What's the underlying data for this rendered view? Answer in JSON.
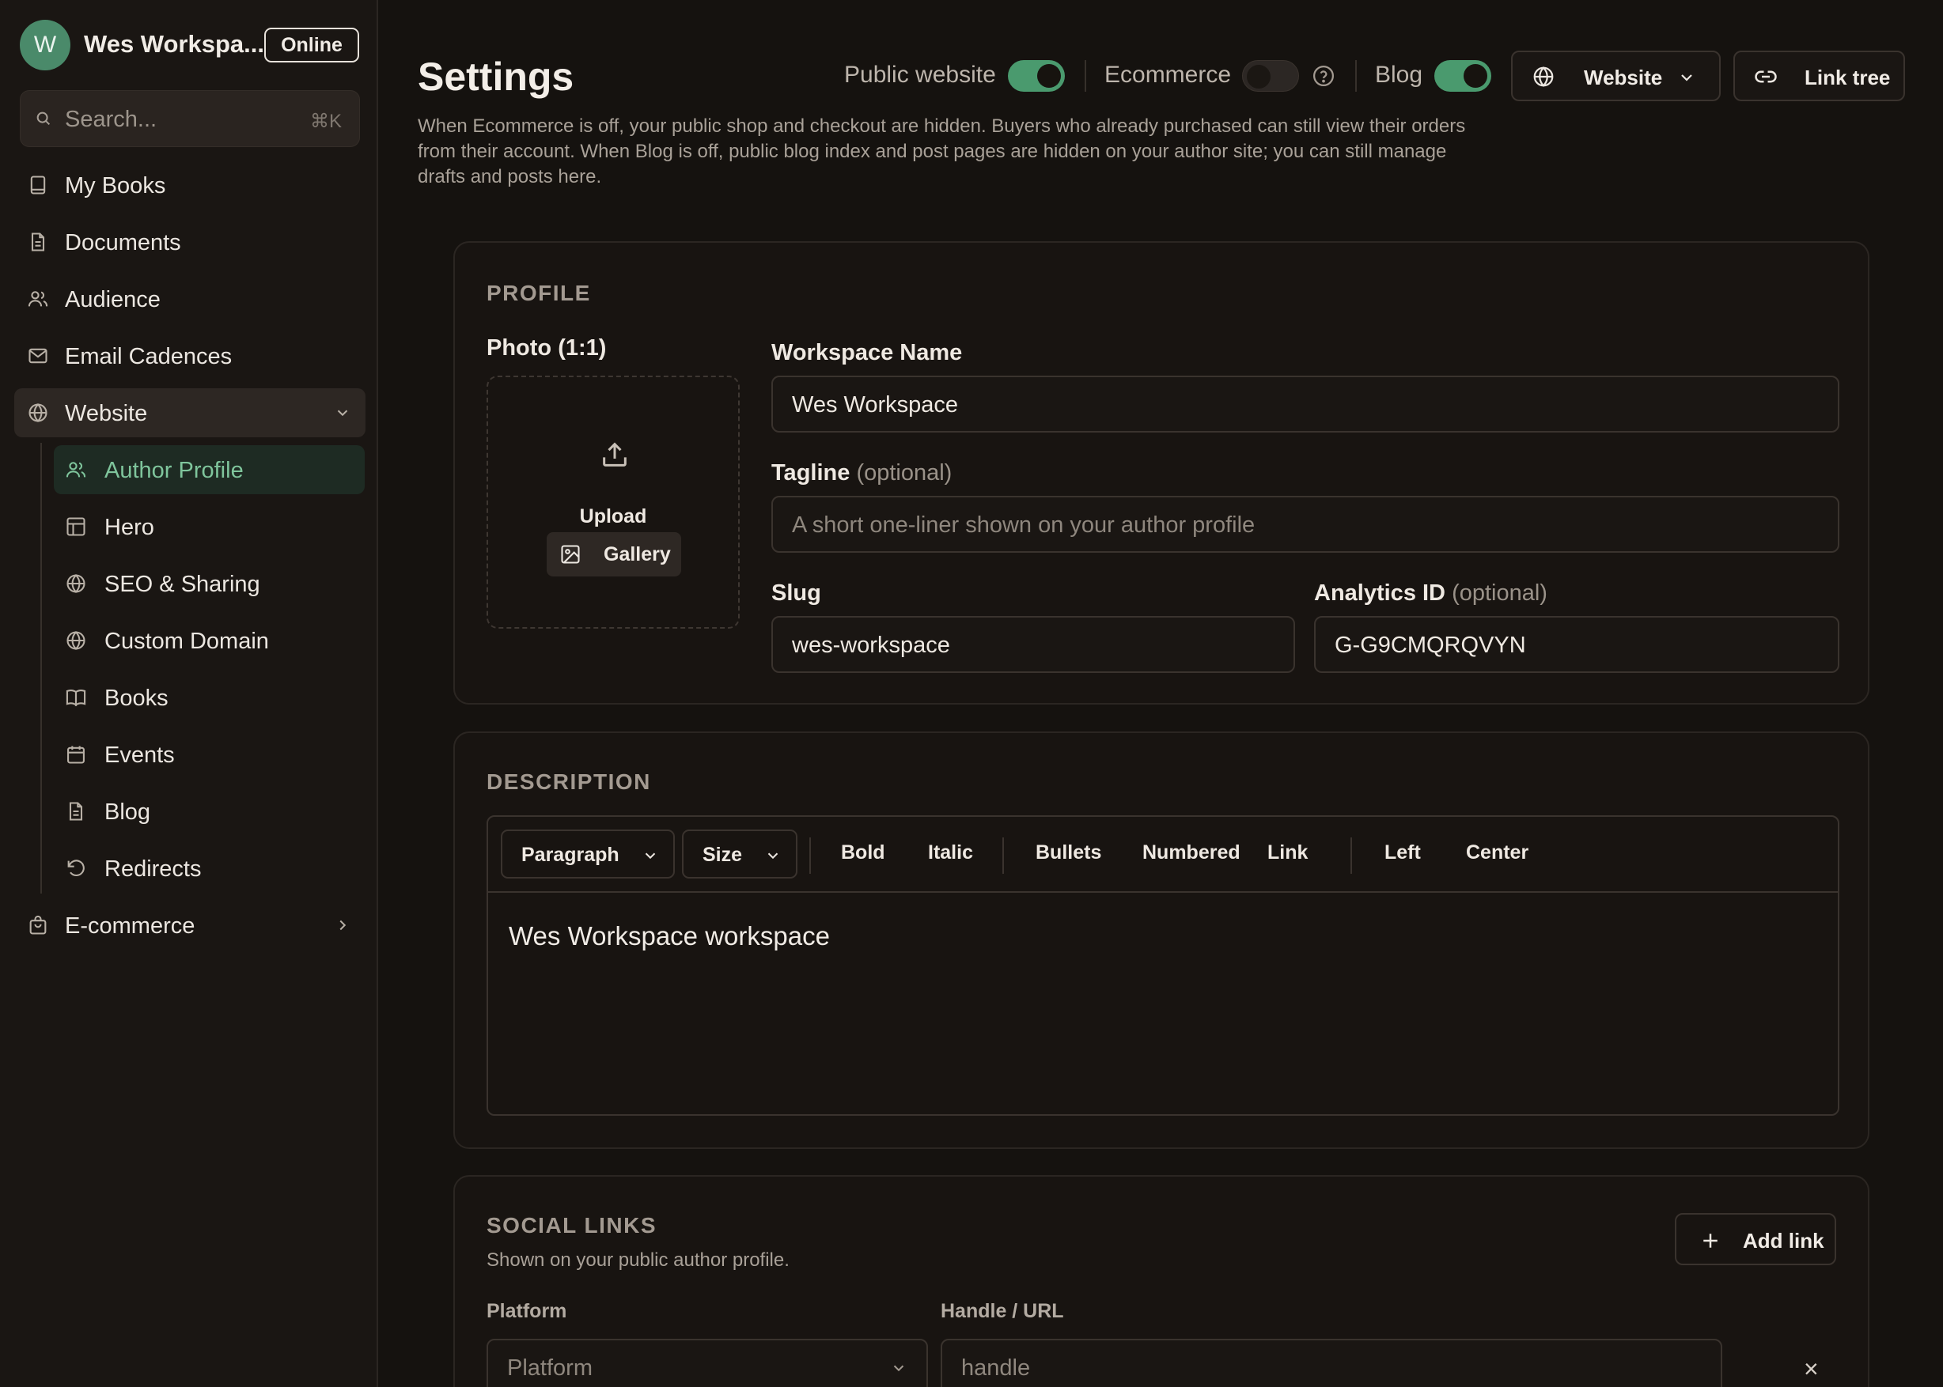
{
  "sidebar": {
    "avatar_initial": "W",
    "workspace_name": "Wes Workspa...",
    "status_label": "Online",
    "search": {
      "placeholder": "Search...",
      "shortcut": "⌘K"
    },
    "items": [
      {
        "label": "My Books",
        "icon": "book-icon"
      },
      {
        "label": "Documents",
        "icon": "document-icon"
      },
      {
        "label": "Audience",
        "icon": "users-icon"
      },
      {
        "label": "Email Cadences",
        "icon": "mail-icon"
      },
      {
        "label": "Website",
        "icon": "globe-icon",
        "expanded": true
      },
      {
        "label": "E-commerce",
        "icon": "shopping-bag-icon",
        "expanded": false
      }
    ],
    "website_subitems": [
      {
        "label": "Author Profile",
        "icon": "users-icon",
        "selected": true
      },
      {
        "label": "Hero",
        "icon": "layout-icon"
      },
      {
        "label": "SEO & Sharing",
        "icon": "globe-icon"
      },
      {
        "label": "Custom Domain",
        "icon": "globe-icon"
      },
      {
        "label": "Books",
        "icon": "open-book-icon"
      },
      {
        "label": "Events",
        "icon": "calendar-icon"
      },
      {
        "label": "Blog",
        "icon": "document-icon"
      },
      {
        "label": "Redirects",
        "icon": "rotate-ccw-icon"
      }
    ]
  },
  "header": {
    "title": "Settings",
    "toggles": [
      {
        "label": "Public website",
        "on": true
      },
      {
        "label": "Ecommerce",
        "on": false
      },
      {
        "label": "Blog",
        "on": true
      }
    ],
    "website_button": "Website",
    "link_tree_button": "Link tree",
    "intro": "When Ecommerce is off, your public shop and checkout are hidden. Buyers who already purchased can still view their orders from their account. When Blog is off, public blog index and post pages are hidden on your author site; you can still manage drafts and posts here."
  },
  "profile": {
    "section_title": "PROFILE",
    "photo_label": "Photo (1:1)",
    "upload_label": "Upload",
    "gallery_label": "Gallery",
    "workspace_name_label": "Workspace Name",
    "workspace_name_value": "Wes Workspace",
    "tagline_label": "Tagline",
    "tagline_optional": "(optional)",
    "tagline_placeholder": "A short one-liner shown on your author profile",
    "slug_label": "Slug",
    "slug_value": "wes-workspace",
    "analytics_label": "Analytics ID",
    "analytics_optional": "(optional)",
    "analytics_value": "G-G9CMQRQVYN"
  },
  "description": {
    "section_title": "DESCRIPTION",
    "paragraph_select": "Paragraph",
    "size_select": "Size",
    "buttons": [
      "Bold",
      "Italic",
      "Bullets",
      "Numbered",
      "Link",
      "Left",
      "Center"
    ],
    "content": "Wes Workspace workspace"
  },
  "social": {
    "section_title": "SOCIAL LINKS",
    "subtitle": "Shown on your public author profile.",
    "add_link": "Add link",
    "platform_label": "Platform",
    "handle_label": "Handle / URL",
    "platform_placeholder": "Platform",
    "handle_placeholder": "handle",
    "remove_glyph": "×"
  },
  "colors": {
    "accent": "#4a9a6e",
    "accent_text": "#7fc59c",
    "background": "#15120f",
    "sidebar": "#1a1613"
  }
}
